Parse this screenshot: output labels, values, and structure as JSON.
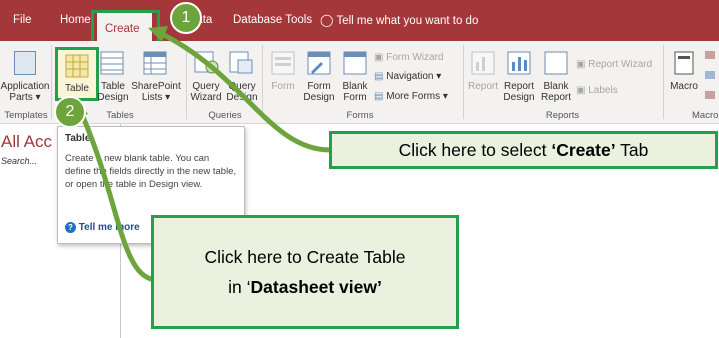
{
  "tabs": [
    {
      "label": "File"
    },
    {
      "label": "Home"
    },
    {
      "label": "Create"
    },
    {
      "label": "Data"
    },
    {
      "label": "Database Tools"
    }
  ],
  "tell_me": "Tell me what you want to do",
  "ribbon": {
    "application_parts": [
      "Application",
      "Parts"
    ],
    "table": "Table",
    "table_design": [
      "Table",
      "Design"
    ],
    "sharepoint": [
      "SharePoint",
      "Lists"
    ],
    "query_wizard": [
      "Query",
      "Wizard"
    ],
    "query_design": [
      "Query",
      "Design"
    ],
    "form": "Form",
    "form_design": [
      "Form",
      "Design"
    ],
    "blank_form": [
      "Blank",
      "Form"
    ],
    "form_wizard": "Form Wizard",
    "navigation": "Navigation",
    "more_forms": "More Forms",
    "report": "Report",
    "report_design": [
      "Report",
      "Design"
    ],
    "blank_report": [
      "Blank",
      "Report"
    ],
    "report_wizard": "Report Wizard",
    "labels": "Labels",
    "macro": "Macro",
    "groups": {
      "templates": "Templates",
      "tables": "Tables",
      "queries": "Queries",
      "forms": "Forms",
      "reports": "Reports",
      "macros": "Macro"
    }
  },
  "nav": {
    "title": "All Acc",
    "search": "Search..."
  },
  "tooltip": {
    "title": "Table",
    "description": "Create a new blank table. You can define the fields directly in the new table, or open the table in Design view.",
    "tell_me_more": "Tell me more"
  },
  "callouts": {
    "create_prefix": "Click here to select ",
    "create_bold": "‘Create’",
    "create_suffix": " Tab",
    "table_line1": "Click here to Create Table",
    "table_prefix": "in ‘",
    "table_bold": "Datasheet view’"
  },
  "badges": [
    "1",
    "2"
  ],
  "colors": {
    "title_bar": "#a4373a",
    "ribbon": "#f3f2f1",
    "highlight": "#22a04b",
    "callout_bg": "#ebf1de",
    "badge": "#6da43b"
  }
}
